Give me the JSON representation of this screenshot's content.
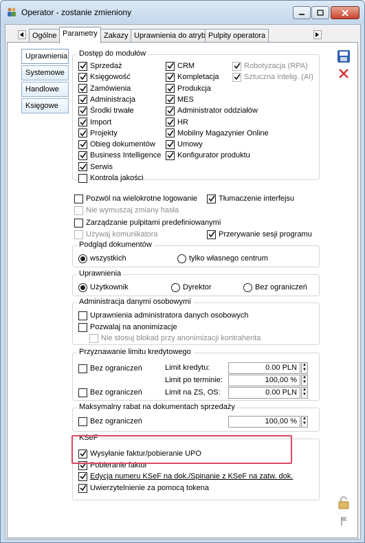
{
  "window": {
    "title": "Operator - zostanie zmieniony"
  },
  "tabs": [
    "Ogólne",
    "Parametry",
    "Zakazy",
    "Uprawnienia do atrybutów",
    "Pulpity operatora"
  ],
  "side_tabs": [
    "Uprawnienia",
    "Systemowe",
    "Handlowe",
    "Księgowe"
  ],
  "modules": {
    "title": "Dostęp do modułów",
    "col1": [
      "Sprzedaż",
      "Księgowość",
      "Zamówienia",
      "Administracja",
      "Środki trwałe",
      "Import",
      "Projekty",
      "Obieg dokumentów",
      "Business Intelligence",
      "Serwis",
      "Kontrola jakości"
    ],
    "col2": [
      "CRM",
      "Kompletacja",
      "Produkcja",
      "MES",
      "Administrator oddziałów",
      "HR",
      "Mobilny Magazynier Online",
      "Umowy",
      "Konfigurator produktu"
    ],
    "col3": [
      "Robotyzacja (RPA)",
      "Sztuczna intelig. (AI)"
    ]
  },
  "options": {
    "multi_login": "Pozwól na wielokrotne logowanie",
    "translate_ui": "Tłumaczenie interfejsu",
    "no_force_password": "Nie wymuszaj zmiany hasła",
    "manage_desktops": "Zarządzanie pulpitami predefiniowanymi",
    "use_messenger": "Używaj komunikatora",
    "interrupt_session": "Przerywanie sesji programu"
  },
  "preview": {
    "title": "Podgląd dokumentów",
    "all": "wszystkich",
    "own": "tylko własnego centrum"
  },
  "permissions": {
    "title": "Uprawnienia",
    "user": "Użytkownik",
    "director": "Dyrektor",
    "unlimited": "Bez ograniczeń"
  },
  "personal": {
    "title": "Administracja danymi osobowymi",
    "admin": "Uprawnienia administratora danych osobowych",
    "anonymize": "Pozwalaj na anonimizacje",
    "no_locks": "Nie stosuj blokad przy anonimizacji kontrahenta"
  },
  "credit": {
    "title": "Przyznawanie limitu kredytowego",
    "unlimited1": "Bez ograniczeń",
    "unlimited2": "Bez ograniczeń",
    "limit_label": "Limit kredytu:",
    "limit_value": "0.00 PLN",
    "overdue_label": "Limit po terminie:",
    "overdue_value": "100,00 %",
    "zs_label": "Limit na ZS, OS:",
    "zs_value": "0.00 PLN"
  },
  "discount": {
    "title": "Maksymalny rabat na dokumentach sprzedaży",
    "unlimited": "Bez ograniczeń",
    "value": "100,00 %"
  },
  "ksef": {
    "title": "KSeF",
    "send": "Wysyłanie faktur/pobieranie UPO",
    "download": "Pobieranie faktur",
    "edit": "Edycja numeru KSeF na dok./Spinanie z KSeF na zatw. dok.",
    "auth": "Uwierzytelnienie za pomocą tokena"
  },
  "colors": {
    "accent": "#d9485f",
    "save": "#2f5fb4",
    "cancel": "#d93535"
  }
}
